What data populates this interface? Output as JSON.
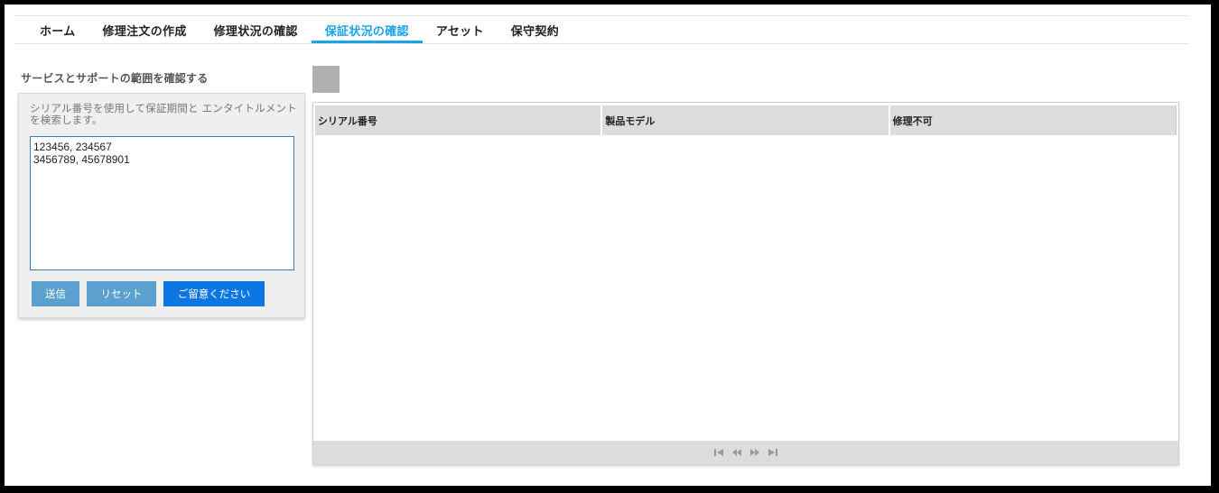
{
  "nav": {
    "tabs": [
      {
        "label": "ホーム"
      },
      {
        "label": "修理注文の作成"
      },
      {
        "label": "修理状況の確認"
      },
      {
        "label": "保証状況の確認",
        "active": true
      },
      {
        "label": "アセット"
      },
      {
        "label": "保守契約"
      }
    ]
  },
  "left": {
    "title": "サービスとサポートの範囲を確認する",
    "description": "シリアル番号を使用して保証期間と エンタイトルメントを検索します。",
    "serial_input_value": "123456, 234567\n3456789, 45678901",
    "buttons": {
      "submit": "送信",
      "reset": "リセット",
      "note": "ご留意ください"
    }
  },
  "grid": {
    "columns": [
      "シリアル番号",
      "製品モデル",
      "修理不可"
    ],
    "rows": [],
    "pager_icons": [
      "first-page-icon",
      "prev-page-icon",
      "next-page-icon",
      "last-page-icon"
    ]
  },
  "colors": {
    "accent": "#1aa3e8",
    "button_light": "#5ba0cf",
    "button_primary": "#0d76e3"
  }
}
